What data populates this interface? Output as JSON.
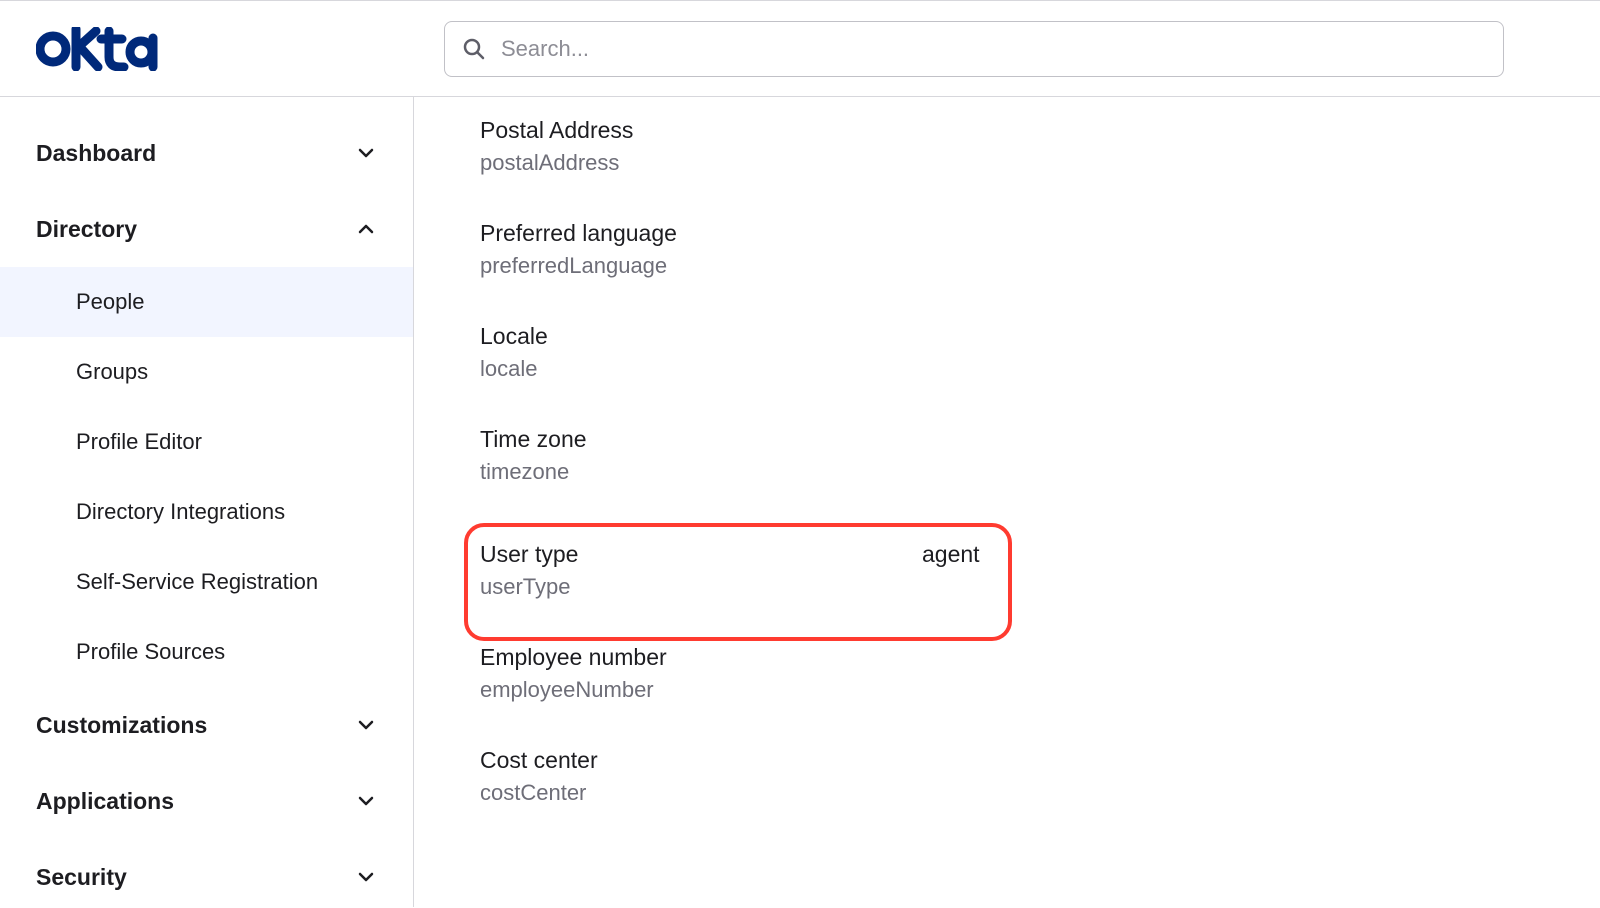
{
  "brand": "okta",
  "search": {
    "placeholder": "Search..."
  },
  "sidebar": {
    "items": [
      {
        "label": "Dashboard",
        "expanded": false
      },
      {
        "label": "Directory",
        "expanded": true,
        "children": [
          {
            "label": "People",
            "active": true
          },
          {
            "label": "Groups"
          },
          {
            "label": "Profile Editor"
          },
          {
            "label": "Directory Integrations"
          },
          {
            "label": "Self-Service Registration"
          },
          {
            "label": "Profile Sources"
          }
        ]
      },
      {
        "label": "Customizations",
        "expanded": false
      },
      {
        "label": "Applications",
        "expanded": false
      },
      {
        "label": "Security",
        "expanded": false
      }
    ]
  },
  "attributes": [
    {
      "label": "Postal Address",
      "key": "postalAddress",
      "value": ""
    },
    {
      "label": "Preferred language",
      "key": "preferredLanguage",
      "value": ""
    },
    {
      "label": "Locale",
      "key": "locale",
      "value": ""
    },
    {
      "label": "Time zone",
      "key": "timezone",
      "value": ""
    },
    {
      "label": "User type",
      "key": "userType",
      "value": "agent",
      "highlighted": true
    },
    {
      "label": "Employee number",
      "key": "employeeNumber",
      "value": ""
    },
    {
      "label": "Cost center",
      "key": "costCenter",
      "value": ""
    }
  ]
}
